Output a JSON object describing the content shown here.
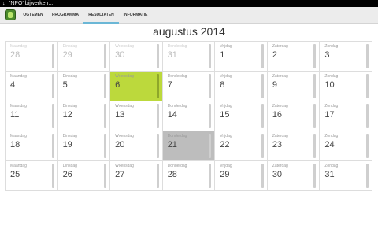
{
  "status_bar": {
    "download_icon": "download-icon",
    "title": "'NPO' bijwerken..."
  },
  "tabs": [
    {
      "label": "OGTEMEN"
    },
    {
      "label": "PROGRAMMA"
    },
    {
      "label": "RESULTATEN"
    },
    {
      "label": "INFORMATIE"
    }
  ],
  "active_tab": "RESULTATEN",
  "colors": {
    "accent": "#6bb7d6",
    "today": "#bcd93c",
    "selected": "#bdbdbd"
  },
  "calendar": {
    "month_title": "augustus 2014",
    "weeks": [
      [
        {
          "day": "Maandag",
          "num": "28",
          "state": "prev"
        },
        {
          "day": "Dinsdag",
          "num": "29",
          "state": "prev"
        },
        {
          "day": "Woensdag",
          "num": "30",
          "state": "prev"
        },
        {
          "day": "Donderdag",
          "num": "31",
          "state": "prev"
        },
        {
          "day": "Vrijdag",
          "num": "1",
          "state": ""
        },
        {
          "day": "Zaterdag",
          "num": "2",
          "state": ""
        },
        {
          "day": "Zondag",
          "num": "3",
          "state": ""
        }
      ],
      [
        {
          "day": "Maandag",
          "num": "4",
          "state": ""
        },
        {
          "day": "Dinsdag",
          "num": "5",
          "state": ""
        },
        {
          "day": "Woensdag",
          "num": "6",
          "state": "today"
        },
        {
          "day": "Donderdag",
          "num": "7",
          "state": ""
        },
        {
          "day": "Vrijdag",
          "num": "8",
          "state": ""
        },
        {
          "day": "Zaterdag",
          "num": "9",
          "state": ""
        },
        {
          "day": "Zondag",
          "num": "10",
          "state": ""
        }
      ],
      [
        {
          "day": "Maandag",
          "num": "11",
          "state": ""
        },
        {
          "day": "Dinsdag",
          "num": "12",
          "state": ""
        },
        {
          "day": "Woensdag",
          "num": "13",
          "state": ""
        },
        {
          "day": "Donderdag",
          "num": "14",
          "state": ""
        },
        {
          "day": "Vrijdag",
          "num": "15",
          "state": ""
        },
        {
          "day": "Zaterdag",
          "num": "16",
          "state": ""
        },
        {
          "day": "Zondag",
          "num": "17",
          "state": ""
        }
      ],
      [
        {
          "day": "Maandag",
          "num": "18",
          "state": ""
        },
        {
          "day": "Dinsdag",
          "num": "19",
          "state": ""
        },
        {
          "day": "Woensdag",
          "num": "20",
          "state": ""
        },
        {
          "day": "Donderdag",
          "num": "21",
          "state": "selected"
        },
        {
          "day": "Vrijdag",
          "num": "22",
          "state": ""
        },
        {
          "day": "Zaterdag",
          "num": "23",
          "state": ""
        },
        {
          "day": "Zondag",
          "num": "24",
          "state": ""
        }
      ],
      [
        {
          "day": "Maandag",
          "num": "25",
          "state": ""
        },
        {
          "day": "Dinsdag",
          "num": "26",
          "state": ""
        },
        {
          "day": "Woensdag",
          "num": "27",
          "state": ""
        },
        {
          "day": "Donderdag",
          "num": "28",
          "state": ""
        },
        {
          "day": "Vrijdag",
          "num": "29",
          "state": ""
        },
        {
          "day": "Zaterdag",
          "num": "30",
          "state": ""
        },
        {
          "day": "Zondag",
          "num": "31",
          "state": ""
        }
      ]
    ]
  }
}
